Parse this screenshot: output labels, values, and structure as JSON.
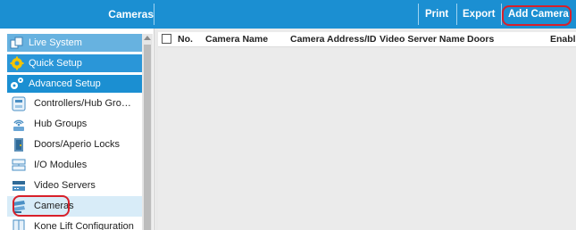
{
  "header": {
    "title": "Cameras",
    "actions": [
      "Print",
      "Export",
      "Add Camera"
    ],
    "accent_color": "#1b8fd2",
    "highlight_color": "#d8202a"
  },
  "sidebar": {
    "sections": [
      {
        "label": "Live System",
        "icon": "live-system-icon"
      },
      {
        "label": "Quick Setup",
        "icon": "gear-icon"
      },
      {
        "label": "Advanced Setup",
        "icon": "settings-icon"
      }
    ],
    "items": [
      {
        "label": "Controllers/Hub Gro…",
        "icon": "controller-icon"
      },
      {
        "label": "Hub Groups",
        "icon": "wireless-hub-icon"
      },
      {
        "label": "Doors/Aperio Locks",
        "icon": "door-icon"
      },
      {
        "label": "I/O Modules",
        "icon": "io-module-icon"
      },
      {
        "label": "Video Servers",
        "icon": "video-server-icon"
      },
      {
        "label": "Cameras",
        "icon": "camera-icon",
        "selected": true
      },
      {
        "label": "Kone Lift Configuration",
        "icon": "lift-icon"
      }
    ]
  },
  "table": {
    "columns": [
      "No.",
      "Camera Name",
      "Camera Address/ID",
      "Video Server Name",
      "Doors",
      "Enabl"
    ],
    "rows": []
  }
}
